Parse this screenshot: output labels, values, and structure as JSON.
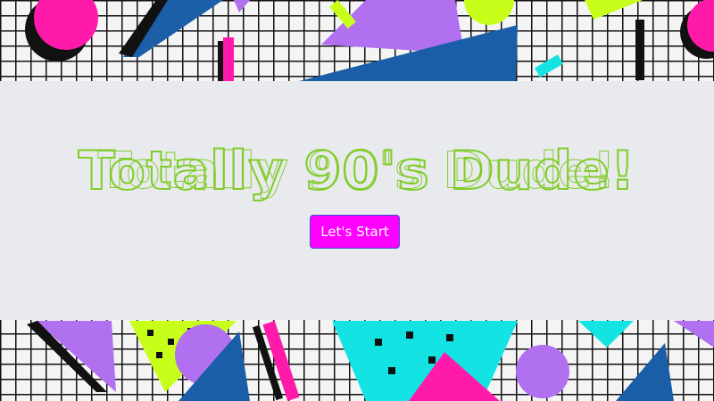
{
  "hero": {
    "title": "Totally 90's Dude!",
    "start_label": "Let's Start"
  },
  "colors": {
    "title": "#80cc28",
    "button": "#ff00ff",
    "band": "#e8eaed"
  }
}
